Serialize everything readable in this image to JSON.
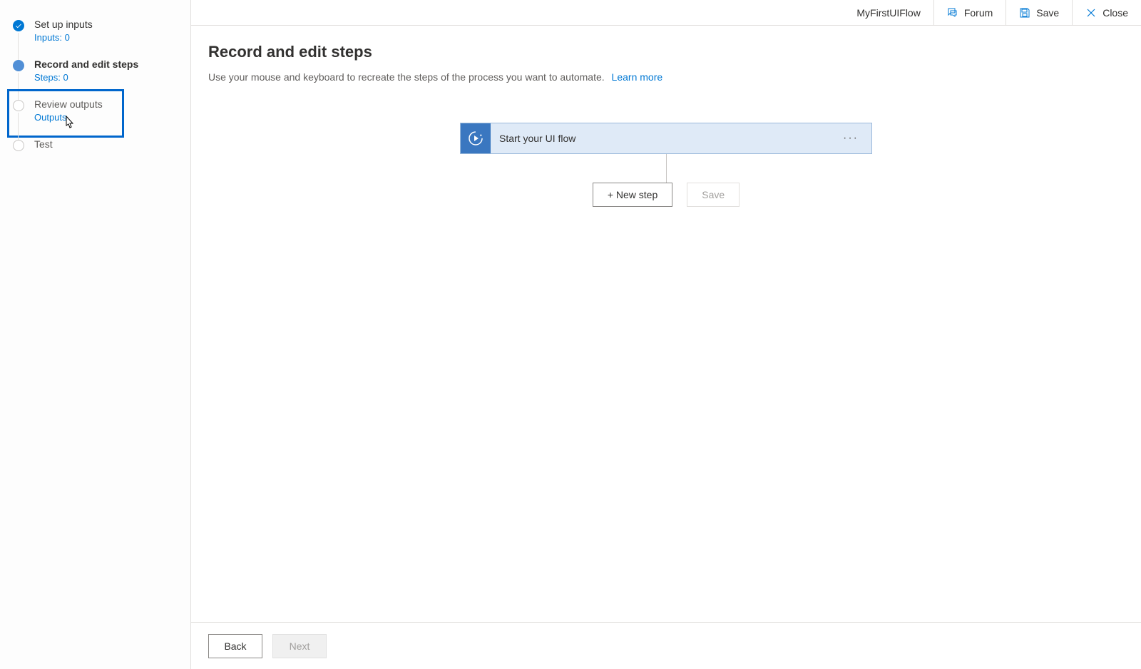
{
  "header": {
    "flow_name": "MyFirstUIFlow",
    "forum_label": "Forum",
    "save_label": "Save",
    "close_label": "Close"
  },
  "sidebar": {
    "steps": [
      {
        "title": "Set up inputs",
        "sub": "Inputs: 0",
        "state": "completed"
      },
      {
        "title": "Record and edit steps",
        "sub": "Steps: 0",
        "state": "current"
      },
      {
        "title": "Review outputs",
        "sub": "Outputs",
        "state": "pending"
      },
      {
        "title": "Test",
        "sub": "",
        "state": "pending"
      }
    ]
  },
  "page": {
    "title": "Record and edit steps",
    "description": "Use your mouse and keyboard to recreate the steps of the process you want to automate.",
    "learn_more": "Learn more"
  },
  "flowcard": {
    "title": "Start your UI flow",
    "menu": "···"
  },
  "canvas_actions": {
    "new_step": "+ New step",
    "save": "Save"
  },
  "footer": {
    "back": "Back",
    "next": "Next"
  }
}
